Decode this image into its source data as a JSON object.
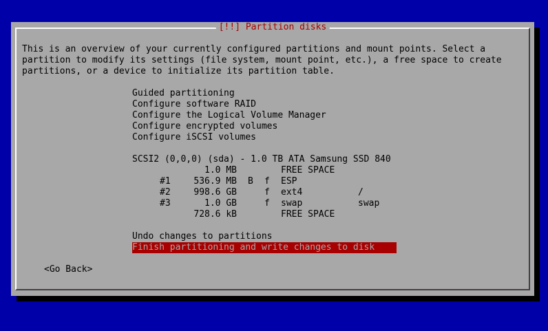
{
  "dialog": {
    "title": "[!!] Partition disks",
    "description_lines": [
      "This is an overview of your currently configured partitions and mount points. Select a",
      "partition to modify its settings (file system, mount point, etc.), a free space to create",
      "partitions, or a device to initialize its partition table."
    ],
    "actions": [
      "Guided partitioning",
      "Configure software RAID",
      "Configure the Logical Volume Manager",
      "Configure encrypted volumes",
      "Configure iSCSI volumes"
    ],
    "disk": {
      "label": "SCSI2 (0,0,0) (sda) - 1.0 TB ATA Samsung SSD 840",
      "partitions": [
        {
          "num": "",
          "size": "1.0 MB",
          "boot": "",
          "fmt": "",
          "fs": "FREE SPACE",
          "mount": ""
        },
        {
          "num": "#1",
          "size": "536.9 MB",
          "boot": "B",
          "fmt": "f",
          "fs": "ESP",
          "mount": ""
        },
        {
          "num": "#2",
          "size": "998.6 GB",
          "boot": "",
          "fmt": "f",
          "fs": "ext4",
          "mount": "/"
        },
        {
          "num": "#3",
          "size": "1.0 GB",
          "boot": "",
          "fmt": "f",
          "fs": "swap",
          "mount": "swap"
        },
        {
          "num": "",
          "size": "728.6 kB",
          "boot": "",
          "fmt": "",
          "fs": "FREE SPACE",
          "mount": ""
        }
      ]
    },
    "undo_label": "Undo changes to partitions",
    "finish_label": "Finish partitioning and write changes to disk",
    "go_back_label": "<Go Back>"
  },
  "colors": {
    "background": "#0000a8",
    "dialog": "#a8a8a8",
    "title": "#a80000",
    "highlight_bg": "#a80000",
    "highlight_fg": "#a8a8a8"
  }
}
